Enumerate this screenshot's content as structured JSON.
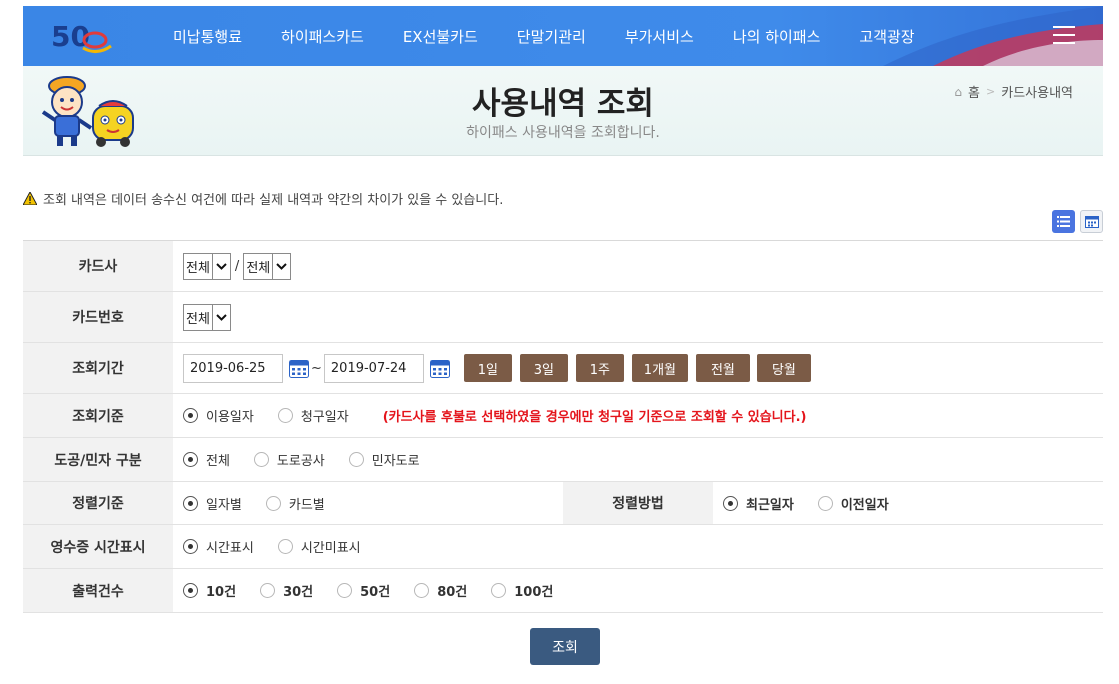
{
  "nav": {
    "logo_text": "50",
    "menu": [
      "미납통행료",
      "하이패스카드",
      "EX선불카드",
      "단말기관리",
      "부가서비스",
      "나의 하이패스",
      "고객광장"
    ]
  },
  "header": {
    "title": "사용내역 조회",
    "subtitle": "하이패스 사용내역을 조회합니다.",
    "breadcrumb": {
      "home": "홈",
      "current": "카드사용내역"
    }
  },
  "notice": "조회 내역은 데이터 송수신 여건에 따라 실제 내역과 약간의 차이가 있을 수 있습니다.",
  "form": {
    "card_company": {
      "label": "카드사",
      "select1": "전체",
      "separator": "/",
      "select2": "전체"
    },
    "card_number": {
      "label": "카드번호",
      "select": "전체"
    },
    "period": {
      "label": "조회기간",
      "start": "2019-06-25",
      "tilde": "~",
      "end": "2019-07-24",
      "buttons": [
        "1일",
        "3일",
        "1주",
        "1개월",
        "전월",
        "당월"
      ]
    },
    "criteria": {
      "label": "조회기준",
      "options": [
        "이용일자",
        "청구일자"
      ],
      "selected": "이용일자",
      "warning": "(카드사를 후불로 선택하였을 경우에만 청구일 기준으로 조회할 수 있습니다.)"
    },
    "road_type": {
      "label": "도공/민자 구분",
      "options": [
        "전체",
        "도로공사",
        "민자도로"
      ],
      "selected": "전체"
    },
    "sort_basis": {
      "label": "정렬기준",
      "options": [
        "일자별",
        "카드별"
      ],
      "selected": "일자별"
    },
    "sort_method": {
      "label": "정렬방법",
      "options": [
        "최근일자",
        "이전일자"
      ],
      "selected": "최근일자"
    },
    "receipt_time": {
      "label": "영수증 시간표시",
      "options": [
        "시간표시",
        "시간미표시"
      ],
      "selected": "시간표시"
    },
    "output_count": {
      "label": "출력건수",
      "options": [
        "10건",
        "30건",
        "50건",
        "80건",
        "100건"
      ],
      "selected": "10건"
    }
  },
  "search_button": "조회",
  "colors": {
    "nav_blue": "#3f8bea",
    "period_button": "#7b5b46",
    "search_button": "#3a5a80",
    "warning_red": "#e4141b"
  }
}
